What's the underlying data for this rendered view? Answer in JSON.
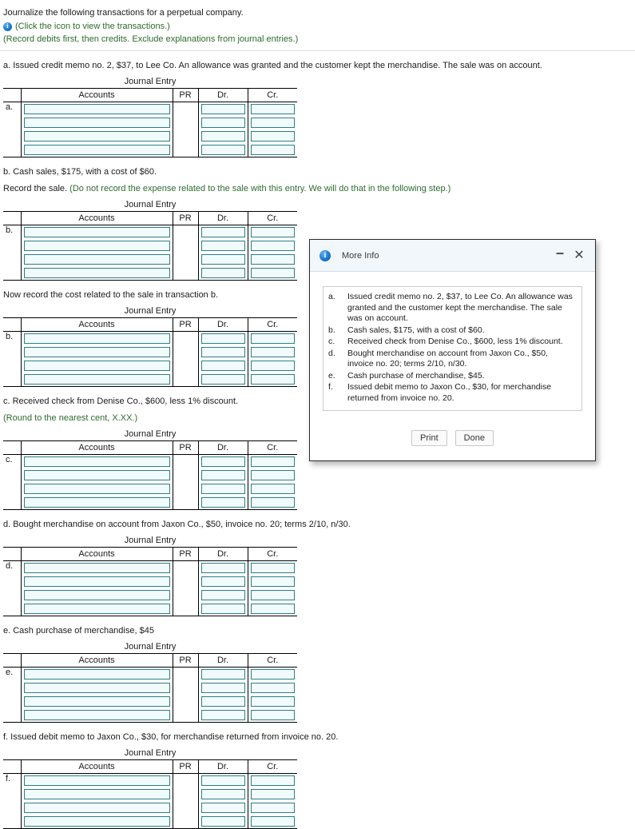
{
  "worksheet": {
    "instructions": {
      "line1": "Journalize the following transactions for a perpetual company.",
      "click_icon": "(Click the icon to view the transactions.)",
      "line2": "(Record debits first, then credits. Exclude explanations from journal entries.)",
      "info_icon_glyph": "i"
    },
    "journal_title": "Journal Entry",
    "columns": {
      "label": "",
      "accounts": "Accounts",
      "pr": "PR",
      "dr": "Dr.",
      "cr": "Cr."
    },
    "sections": [
      {
        "id": "a",
        "heading": "a. Issued credit memo no. 2, $37, to Lee Co. An allowance was granted and the customer kept the merchandise. The sale was on account.",
        "subheading": "",
        "subheading_hint": "",
        "row_label": "a.",
        "rows": 4
      },
      {
        "id": "b",
        "heading": "b. Cash sales, $175, with a cost of $60.",
        "subheading": "Record the sale. ",
        "subheading_hint": "(Do not record the expense related to the sale with this entry. We will do that in the following step.)",
        "row_label": "b.",
        "rows": 4
      },
      {
        "id": "b2",
        "heading": "Now record the cost related to the sale in transaction b.",
        "subheading": "",
        "subheading_hint": "",
        "row_label": "b.",
        "rows": 4
      },
      {
        "id": "c",
        "heading": "c. Received check from Denise Co., $600, less 1% discount. ",
        "subheading": "",
        "subheading_hint": "(Round to the nearest cent, X.XX.)",
        "row_label": "c.",
        "rows": 4
      },
      {
        "id": "d",
        "heading": "d. Bought merchandise on account from Jaxon Co., $50, invoice no. 20; terms 2/10, n/30.",
        "subheading": "",
        "subheading_hint": "",
        "row_label": "d.",
        "rows": 4
      },
      {
        "id": "e",
        "heading": "e. Cash purchase of merchandise, $45",
        "subheading": "",
        "subheading_hint": "",
        "row_label": "e.",
        "rows": 4
      },
      {
        "id": "f",
        "heading": "f. Issued debit memo to Jaxon Co., $30, for merchandise returned from invoice no. 20.",
        "subheading": "",
        "subheading_hint": "",
        "row_label": "f.",
        "rows": 4
      }
    ]
  },
  "modal": {
    "title": "More Info",
    "info_icon_glyph": "i",
    "minimize_glyph": "–",
    "close_glyph": "✕",
    "items": [
      {
        "key": "a.",
        "text": "Issued credit memo no. 2, $37, to Lee Co. An allowance was granted and the customer kept the merchandise. The sale was on account."
      },
      {
        "key": "b.",
        "text": "Cash sales, $175, with a cost of $60."
      },
      {
        "key": "c.",
        "text": "Received check from Denise Co., $600, less 1% discount."
      },
      {
        "key": "d.",
        "text": "Bought merchandise on account from Jaxon Co., $50, invoice no. 20; terms 2/10, n/30."
      },
      {
        "key": "e.",
        "text": "Cash purchase of merchandise, $45."
      },
      {
        "key": "f.",
        "text": "Issued debit memo to Jaxon Co., $30, for merchandise returned from invoice no. 20."
      }
    ],
    "print_label": "Print",
    "done_label": "Done"
  },
  "colors": {
    "input_border": "#2a7f86",
    "input_fill": "#f2fbfc",
    "hint_green": "#2e6b2e",
    "info_blue": "#1a79cf"
  }
}
